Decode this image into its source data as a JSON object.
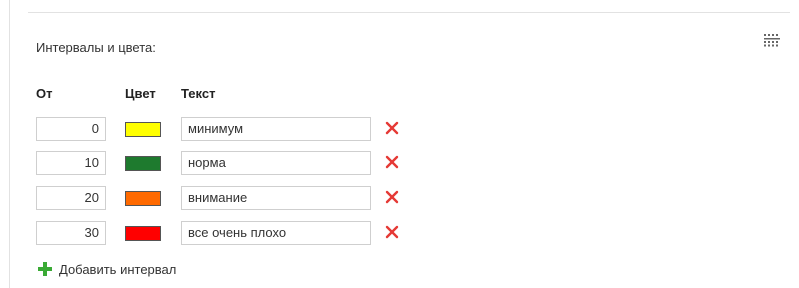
{
  "section": {
    "title": "Интервалы и цвета:",
    "grid_icon": "grid-dots-icon"
  },
  "columns": {
    "from": "От",
    "color": "Цвет",
    "text": "Текст"
  },
  "intervals": [
    {
      "from": "0",
      "color": "#ffff00",
      "text": "минимум"
    },
    {
      "from": "10",
      "color": "#1e7a2e",
      "text": "норма"
    },
    {
      "from": "20",
      "color": "#ff6a00",
      "text": "внимание"
    },
    {
      "from": "30",
      "color": "#ff0000",
      "text": "все очень плохо"
    }
  ],
  "delete_icon": "close-x-icon",
  "delete_color": "#e53935",
  "add_button": {
    "label": "Добавить интервал",
    "icon": "plus-icon",
    "icon_color": "#3aaa35"
  }
}
